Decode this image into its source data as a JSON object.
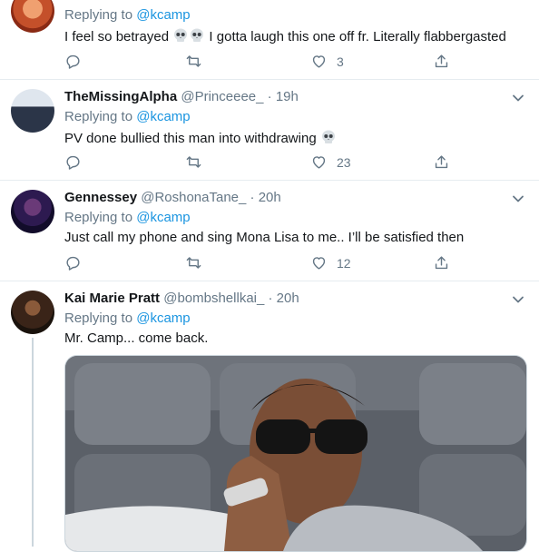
{
  "tweets": [
    {
      "name": "",
      "handle": "",
      "replying_label": "Replying to",
      "replying_to": "@kcamp",
      "text_before": "I feel so betrayed",
      "text_after": "I gotta laugh this one off fr. Literally flabbergasted",
      "likes": "3"
    },
    {
      "name": "TheMissingAlpha",
      "handle": "@Princeeee_",
      "time": "· 19h",
      "replying_label": "Replying to",
      "replying_to": "@kcamp",
      "text": "PV done bullied this man into withdrawing",
      "likes": "23"
    },
    {
      "name": "Gennessey",
      "handle": "@RoshonaTane_",
      "time": "· 20h",
      "replying_label": "Replying to",
      "replying_to": "@kcamp",
      "text": "Just call my phone and sing Mona Lisa to me.. I’ll be satisfied then",
      "likes": "12"
    },
    {
      "name": "Kai Marie Pratt",
      "handle": "@bombshellkai_",
      "time": "· 20h",
      "replying_label": "Replying to",
      "replying_to": "@kcamp",
      "text": "Mr. Camp... come back."
    }
  ],
  "icons": {
    "reply": "reply-icon",
    "retweet": "retweet-icon",
    "like": "heart-icon",
    "share": "share-icon",
    "menu": "chevron-down-icon",
    "emoji": "skull-emoji"
  },
  "colors": {
    "link": "#1b95e0",
    "muted": "#657786",
    "border": "#e6ecf0"
  }
}
